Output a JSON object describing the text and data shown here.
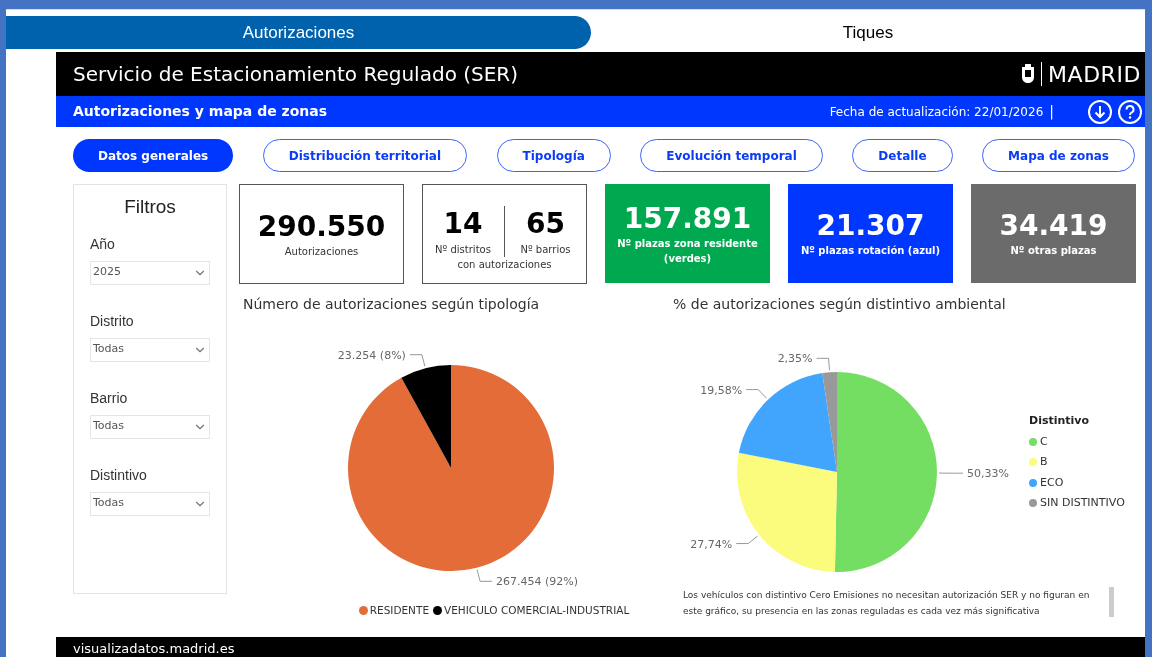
{
  "tabs": [
    {
      "label": "Autorizaciones",
      "selected": true
    },
    {
      "label": "Tiques",
      "selected": false
    }
  ],
  "header": {
    "title": "Servicio de Estacionamiento Regulado (SER)",
    "brand": "MADRID"
  },
  "subheader": {
    "title": "Autorizaciones y mapa de zonas",
    "updated": "Fecha de actualización: 22/01/2026",
    "separator": "|"
  },
  "nav": [
    {
      "label": "Datos generales",
      "selected": true
    },
    {
      "label": "Distribución territorial",
      "selected": false
    },
    {
      "label": "Tipología",
      "selected": false
    },
    {
      "label": "Evolución temporal",
      "selected": false
    },
    {
      "label": "Detalle",
      "selected": false
    },
    {
      "label": "Mapa de zonas",
      "selected": false
    }
  ],
  "filters": {
    "title": "Filtros",
    "items": [
      {
        "label": "Año",
        "value": "2025"
      },
      {
        "label": "Distrito",
        "value": "Todas"
      },
      {
        "label": "Barrio",
        "value": "Todas"
      },
      {
        "label": "Distintivo",
        "value": "Todas"
      }
    ]
  },
  "cards": [
    {
      "kind": "single",
      "value": "290.550",
      "label": "Autorizaciones",
      "color": "#ffffff"
    },
    {
      "kind": "double",
      "values": [
        {
          "value": "14",
          "label": "Nº distritos"
        },
        {
          "value": "65",
          "label": "Nº barrios"
        }
      ],
      "label": "con autorizaciones",
      "color": "#ffffff"
    },
    {
      "kind": "single",
      "value": "157.891",
      "label": "Nº plazas zona residente (verdes)",
      "color": "#00a84f"
    },
    {
      "kind": "single",
      "value": "21.307",
      "label": "Nº plazas rotación (azul)",
      "color": "#0037ff"
    },
    {
      "kind": "single",
      "value": "34.419",
      "label": "Nº otras plazas",
      "color": "#6b6b6b"
    }
  ],
  "charts": [
    {
      "chart_data": {
        "type": "pie",
        "title": "Número de autorizaciones según tipología",
        "categories": [
          "RESIDENTE",
          "VEHICULO COMERCIAL-INDUSTRIAL"
        ],
        "values": [
          92,
          8
        ],
        "colors": [
          "#e46c38",
          "#000000"
        ],
        "value_labels": [
          "267.454 (92%)",
          "23.254 (8%)"
        ]
      }
    },
    {
      "chart_data": {
        "type": "pie",
        "title": "% de autorizaciones según distintivo ambiental",
        "legend_title": "Distintivo",
        "categories": [
          "C",
          "B",
          "ECO",
          "SIN DISTINTIVO"
        ],
        "values": [
          50.33,
          27.74,
          19.58,
          2.35
        ],
        "colors": [
          "#74de63",
          "#fbfc7d",
          "#41a5fe",
          "#999999"
        ],
        "value_labels": [
          "50,33%",
          "27,74%",
          "19,58%",
          "2,35%"
        ]
      },
      "note": "Los vehículos con distintivo Cero Emisiones no necesitan autorización SER y no figuran en este gráfico, su presencia en las zonas reguladas es cada vez más significativa"
    }
  ],
  "footer": {
    "text": "visualizadatos.madrid.es"
  }
}
